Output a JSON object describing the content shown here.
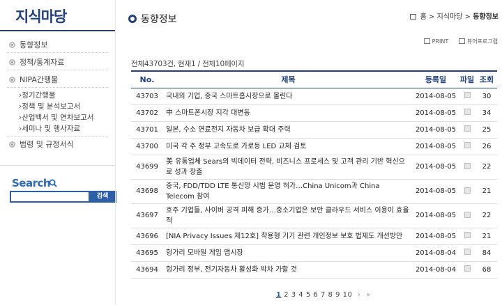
{
  "sidebar": {
    "brand": "지식마당",
    "menu": [
      {
        "label": "동향정보"
      },
      {
        "label": "정책/통계자료"
      },
      {
        "label": "NIPA간행물"
      }
    ],
    "submenu": [
      {
        "label": "›정기간행물"
      },
      {
        "label": "›정책 및 분석보고서"
      },
      {
        "label": "›산업백서 및 연차보고서"
      },
      {
        "label": "›세미나 및 행사자료"
      }
    ],
    "menu_last": {
      "label": "법령 및 규정서식"
    },
    "search": {
      "title": "Search",
      "button": "검색",
      "value": ""
    }
  },
  "header": {
    "title": "동향정보",
    "breadcrumb": {
      "home": "홈",
      "sep1": ">",
      "mid": "지식마당",
      "sep2": ">",
      "current": "동향정보"
    }
  },
  "tools": {
    "print": "PRINT",
    "view": "뷰어프로그램"
  },
  "count": {
    "total": "전체43703건, 현재1 / 전체10페이지"
  },
  "table": {
    "headers": {
      "no": "No.",
      "subject": "제목",
      "date": "등록일",
      "file": "파일",
      "views": "조회"
    },
    "rows": [
      {
        "no": "43703",
        "subject": "국내외 기업, 중국 스마트홈시장으로 몰린다",
        "date": "2014-08-05",
        "views": "30"
      },
      {
        "no": "43702",
        "subject": "中 스마트폰시장 지각 대변동",
        "date": "2014-08-05",
        "views": "34"
      },
      {
        "no": "43701",
        "subject": "일본, 수소 연료전지 자동차 보급 확대 주력",
        "date": "2014-08-05",
        "views": "25"
      },
      {
        "no": "43700",
        "subject": "미국 각 주 정부 고속도로 가로등 LED 교체 검토",
        "date": "2014-08-05",
        "views": "26"
      },
      {
        "no": "43699",
        "subject": "美 유통업체 Sears의 빅데이터 전략, 비즈니스 프로세스 및 고객 관리 기반 혁신으로 성과 창출",
        "date": "2014-08-05",
        "views": "22"
      },
      {
        "no": "43698",
        "subject": "중국, FDD/TDD LTE 통신망 시범 운영 허가…China Unicom과 China Telecom 참여",
        "date": "2014-08-05",
        "views": "21"
      },
      {
        "no": "43697",
        "subject": "호주 기업들, 사이버 공격 피해 증가…중소기업은 보안 클라우드 서비스 이용이 효율적",
        "date": "2014-08-05",
        "views": "22"
      },
      {
        "no": "43696",
        "subject": "[NIA Privacy Issues 제12호] 착용형 기기 관련 개인정보 보호 법제도 개선방안",
        "date": "2014-08-05",
        "views": "21"
      },
      {
        "no": "43695",
        "subject": "헝가리 모바일 게임 앱시장",
        "date": "2014-08-04",
        "views": "84"
      },
      {
        "no": "43694",
        "subject": "헝가리 정부, 전기자동차 활성화 박차 가할 것",
        "date": "2014-08-04",
        "views": "68"
      }
    ]
  },
  "pager": {
    "pages": [
      "1",
      "2",
      "3",
      "4",
      "5",
      "6",
      "7",
      "8",
      "9",
      "10"
    ],
    "next": "›",
    "last": "»"
  }
}
